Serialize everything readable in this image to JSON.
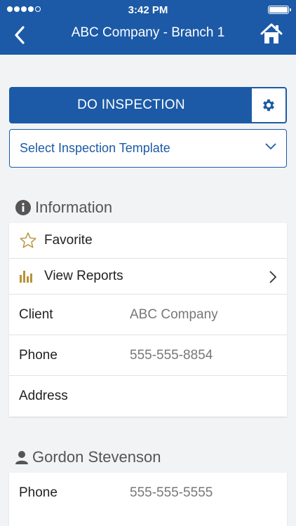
{
  "status_bar": {
    "time": "3:42 PM"
  },
  "nav": {
    "title": "ABC Company - Branch 1"
  },
  "inspection": {
    "do_label": "DO INSPECTION",
    "template_placeholder": "Select Inspection Template"
  },
  "information": {
    "heading": "Information",
    "favorite_label": "Favorite",
    "view_reports_label": "View Reports",
    "fields": [
      {
        "label": "Client",
        "value": "ABC Company"
      },
      {
        "label": "Phone",
        "value": "555-555-8854"
      },
      {
        "label": "Address",
        "value": ""
      }
    ]
  },
  "contact": {
    "name": "Gordon Stevenson",
    "fields": [
      {
        "label": "Phone",
        "value": "555-555-5555"
      }
    ]
  },
  "colors": {
    "brand": "#1c5aa7",
    "accent_gold": "#b8913a",
    "background": "#f2f3f5"
  },
  "icons": [
    "back-chevron-icon",
    "home-icon",
    "gear-icon",
    "chevron-down-icon",
    "info-icon",
    "star-icon",
    "bar-chart-icon",
    "chevron-right-icon",
    "person-icon"
  ]
}
